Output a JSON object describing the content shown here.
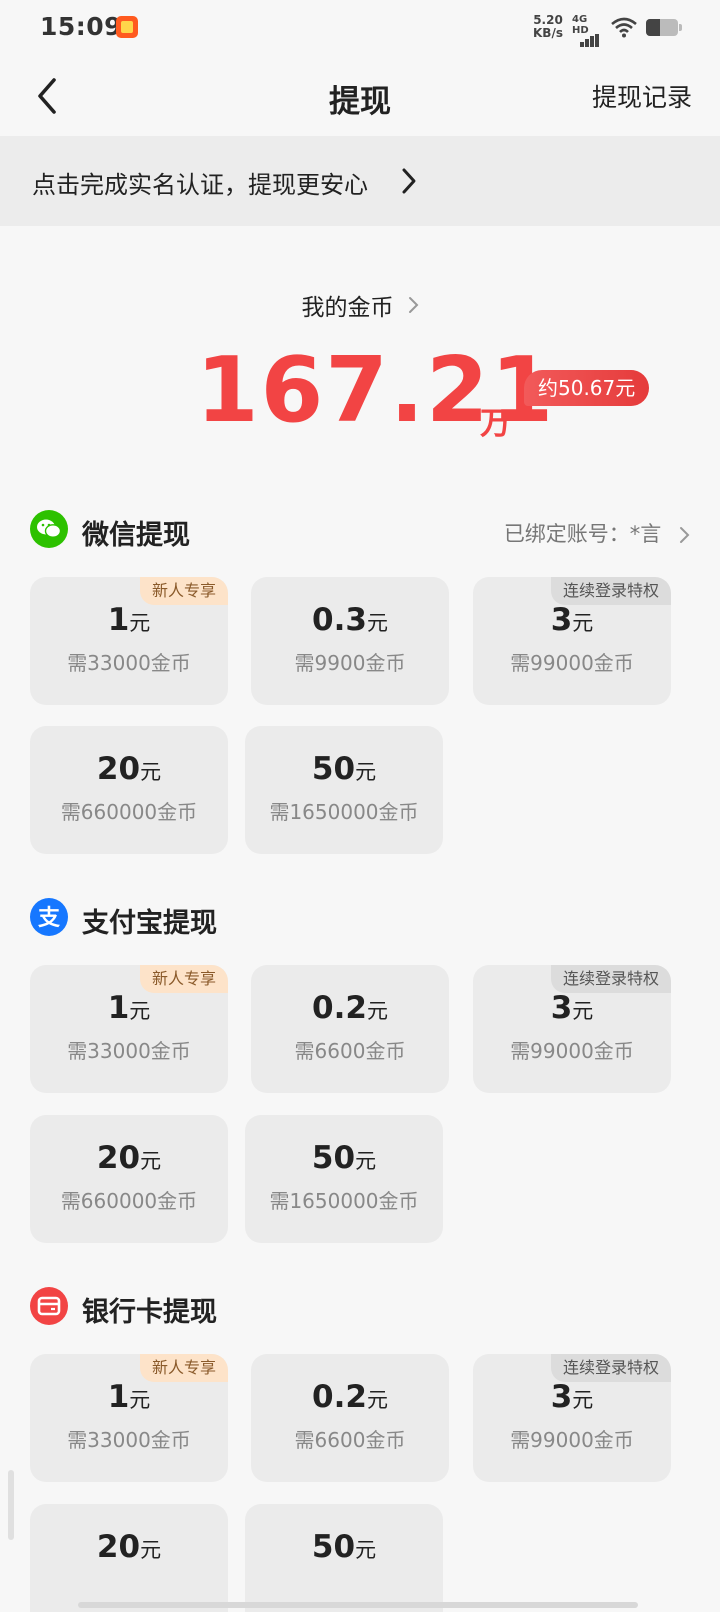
{
  "status_bar": {
    "time": "15:09",
    "net_speed_value": "5.20",
    "net_speed_unit": "KB/s",
    "network_label": "4G HD"
  },
  "nav": {
    "title": "提现",
    "right_label": "提现记录"
  },
  "banner": {
    "text": "点击完成实名认证，提现更安心"
  },
  "coins": {
    "label": "我的金币",
    "amount": "167.21",
    "unit": "万",
    "approx": "约50.67元"
  },
  "sections": {
    "wechat": {
      "title": "微信提现",
      "bound_account": "已绑定账号：*言",
      "icon": "wechat-icon",
      "color": "#2dc100",
      "cards": [
        {
          "amount": "1",
          "unit": "元",
          "need": "需33000金币",
          "tag": "新人专享"
        },
        {
          "amount": "0.3",
          "unit": "元",
          "need": "需9900金币",
          "tag": ""
        },
        {
          "amount": "3",
          "unit": "元",
          "need": "需99000金币",
          "tag": "连续登录特权"
        },
        {
          "amount": "20",
          "unit": "元",
          "need": "需660000金币",
          "tag": ""
        },
        {
          "amount": "50",
          "unit": "元",
          "need": "需1650000金币",
          "tag": ""
        }
      ]
    },
    "alipay": {
      "title": "支付宝提现",
      "icon": "alipay-icon",
      "color": "#1677ff",
      "cards": [
        {
          "amount": "1",
          "unit": "元",
          "need": "需33000金币",
          "tag": "新人专享"
        },
        {
          "amount": "0.2",
          "unit": "元",
          "need": "需6600金币",
          "tag": ""
        },
        {
          "amount": "3",
          "unit": "元",
          "need": "需99000金币",
          "tag": "连续登录特权"
        },
        {
          "amount": "20",
          "unit": "元",
          "need": "需660000金币",
          "tag": ""
        },
        {
          "amount": "50",
          "unit": "元",
          "need": "需1650000金币",
          "tag": ""
        }
      ]
    },
    "bank": {
      "title": "银行卡提现",
      "icon": "bank-card-icon",
      "color": "#f24444",
      "cards": [
        {
          "amount": "1",
          "unit": "元",
          "need": "需33000金币",
          "tag": "新人专享"
        },
        {
          "amount": "0.2",
          "unit": "元",
          "need": "需6600金币",
          "tag": ""
        },
        {
          "amount": "3",
          "unit": "元",
          "need": "需99000金币",
          "tag": "连续登录特权"
        },
        {
          "amount": "20",
          "unit": "元",
          "need": "",
          "tag": ""
        },
        {
          "amount": "50",
          "unit": "元",
          "need": "",
          "tag": ""
        }
      ]
    }
  }
}
